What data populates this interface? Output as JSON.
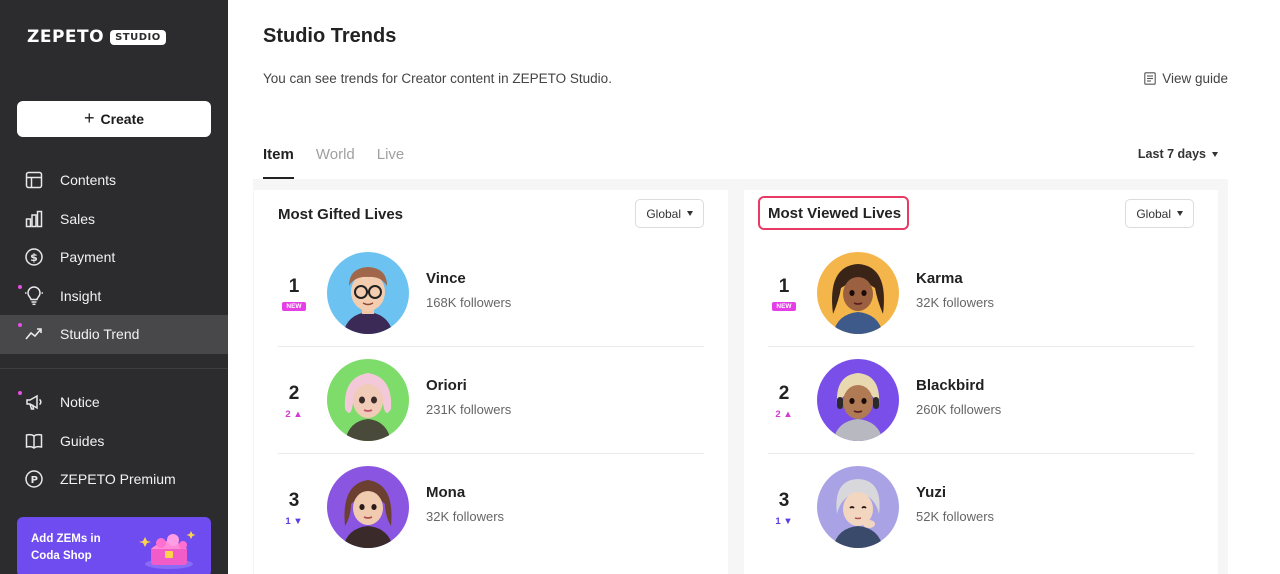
{
  "sidebar": {
    "logo": "ZEPETO",
    "logo_badge": "STUDIO",
    "create_label": "Create",
    "items": [
      {
        "label": "Contents",
        "icon": "layout-icon"
      },
      {
        "label": "Sales",
        "icon": "bar-chart-icon"
      },
      {
        "label": "Payment",
        "icon": "dollar-circle-icon"
      },
      {
        "label": "Insight",
        "icon": "lightbulb-icon"
      },
      {
        "label": "Studio Trend",
        "icon": "trend-icon"
      },
      {
        "label": "Notice",
        "icon": "megaphone-icon"
      },
      {
        "label": "Guides",
        "icon": "book-icon"
      },
      {
        "label": "ZEPETO Premium",
        "icon": "premium-icon"
      }
    ],
    "promo": {
      "line1": "Add ZEMs in",
      "line2": "Coda Shop"
    }
  },
  "header": {
    "title": "Studio Trends",
    "description": "You can see trends for Creator content in ZEPETO Studio.",
    "view_guide": "View guide"
  },
  "tabs": [
    "Item",
    "World",
    "Live"
  ],
  "period": "Last 7 days",
  "cards": [
    {
      "title": "Most Gifted Lives",
      "region": "Global",
      "rows": [
        {
          "rank": "1",
          "badge": "NEW",
          "change": "",
          "name": "Vince",
          "followers": "168K followers"
        },
        {
          "rank": "2",
          "badge": "",
          "change": "2 ▲",
          "name": "Oriori",
          "followers": "231K followers"
        },
        {
          "rank": "3",
          "badge": "",
          "change": "1 ▼",
          "name": "Mona",
          "followers": "32K followers"
        }
      ]
    },
    {
      "title": "Most Viewed Lives",
      "region": "Global",
      "rows": [
        {
          "rank": "1",
          "badge": "NEW",
          "change": "",
          "name": "Karma",
          "followers": "32K followers"
        },
        {
          "rank": "2",
          "badge": "",
          "change": "2 ▲",
          "name": "Blackbird",
          "followers": "260K followers"
        },
        {
          "rank": "3",
          "badge": "",
          "change": "1 ▼",
          "name": "Yuzi",
          "followers": "52K followers"
        }
      ]
    }
  ],
  "colors": {
    "sidebar_bg": "#2c2c2e",
    "accent_purple": "#6e4cf0",
    "new_badge": "#e63ee6",
    "highlight_border": "#e83a64"
  }
}
